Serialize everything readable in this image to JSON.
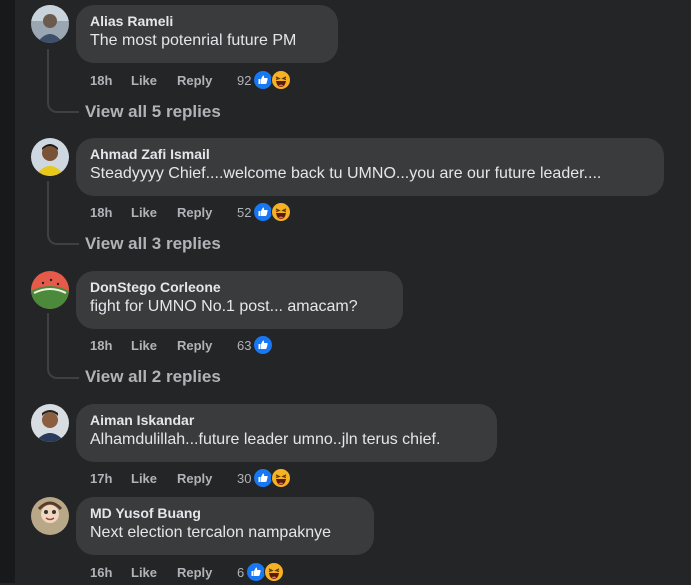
{
  "comments": [
    {
      "author": "Alias Rameli",
      "text": "The most potenrial future PM",
      "time": "18h",
      "like": "Like",
      "reply": "Reply",
      "reactions_count": "92",
      "reactions": [
        "like-icon",
        "haha-icon"
      ],
      "view_replies": "View all 5 replies"
    },
    {
      "author": "Ahmad Zafi Ismail",
      "text": "Steadyyyy Chief....welcome back tu UMNO...you are our future leader....",
      "time": "18h",
      "like": "Like",
      "reply": "Reply",
      "reactions_count": "52",
      "reactions": [
        "like-icon",
        "haha-icon"
      ],
      "view_replies": "View all 3 replies"
    },
    {
      "author": "DonStego Corleone",
      "text": "fight for UMNO No.1 post... amacam?",
      "time": "18h",
      "like": "Like",
      "reply": "Reply",
      "reactions_count": "63",
      "reactions": [
        "like-icon"
      ],
      "view_replies": "View all 2 replies"
    },
    {
      "author": "Aiman Iskandar",
      "text": "Alhamdulillah...future leader umno..jln terus chief.",
      "time": "17h",
      "like": "Like",
      "reply": "Reply",
      "reactions_count": "30",
      "reactions": [
        "like-icon",
        "haha-icon"
      ]
    },
    {
      "author": "MD Yusof Buang",
      "text": "Next election tercalon nampaknye",
      "time": "16h",
      "like": "Like",
      "reply": "Reply",
      "reactions_count": "6",
      "reactions": [
        "like-icon",
        "haha-icon"
      ]
    }
  ],
  "colors": {
    "background": "#242526",
    "bubble": "#3a3b3c",
    "text": "#e4e6eb",
    "secondary": "#b0b3b8",
    "like_blue": "#1877f2",
    "haha_yellow": "#f7b125"
  }
}
